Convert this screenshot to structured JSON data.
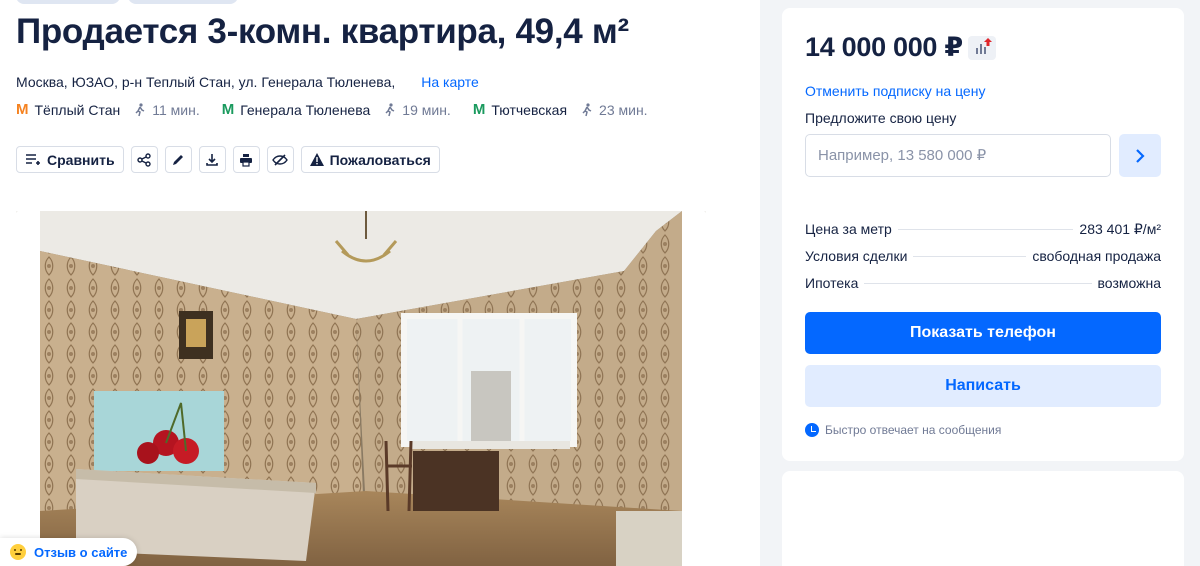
{
  "listing": {
    "title": "Продается 3-комн. квартира, 49,4 м²",
    "address": "Москва, ЮЗАО, р-н Теплый Стан, ул. Генерала Тюленева,",
    "map_link": "На карте",
    "metros": [
      {
        "name": "Тёплый Стан",
        "time": "11 мин.",
        "color": "#f58220"
      },
      {
        "name": "Генерала Тюленева",
        "time": "19 мин.",
        "color": "#1a9a5e"
      },
      {
        "name": "Тютчевская",
        "time": "23 мин.",
        "color": "#1a9a5e"
      }
    ]
  },
  "toolbar": {
    "compare": "Сравнить",
    "complain": "Пожаловаться",
    "icons": [
      "share-icon",
      "edit-icon",
      "download-icon",
      "print-icon",
      "hide-icon"
    ]
  },
  "sidebar": {
    "price": "14 000 000 ₽",
    "unsubscribe": "Отменить подписку на цену",
    "offer_label": "Предложите свою цену",
    "offer_placeholder": "Например, 13 580 000 ₽",
    "facts": [
      {
        "label": "Цена за метр",
        "value": "283 401 ₽/м²"
      },
      {
        "label": "Условия сделки",
        "value": "свободная продажа"
      },
      {
        "label": "Ипотека",
        "value": "возможна"
      }
    ],
    "show_phone": "Показать телефон",
    "write": "Написать",
    "fast_reply": "Быстро отвечает на сообщения"
  },
  "feedback": "Отзыв о сайте",
  "colors": {
    "accent": "#0468ff",
    "text": "#152242",
    "muted": "#707a95"
  }
}
